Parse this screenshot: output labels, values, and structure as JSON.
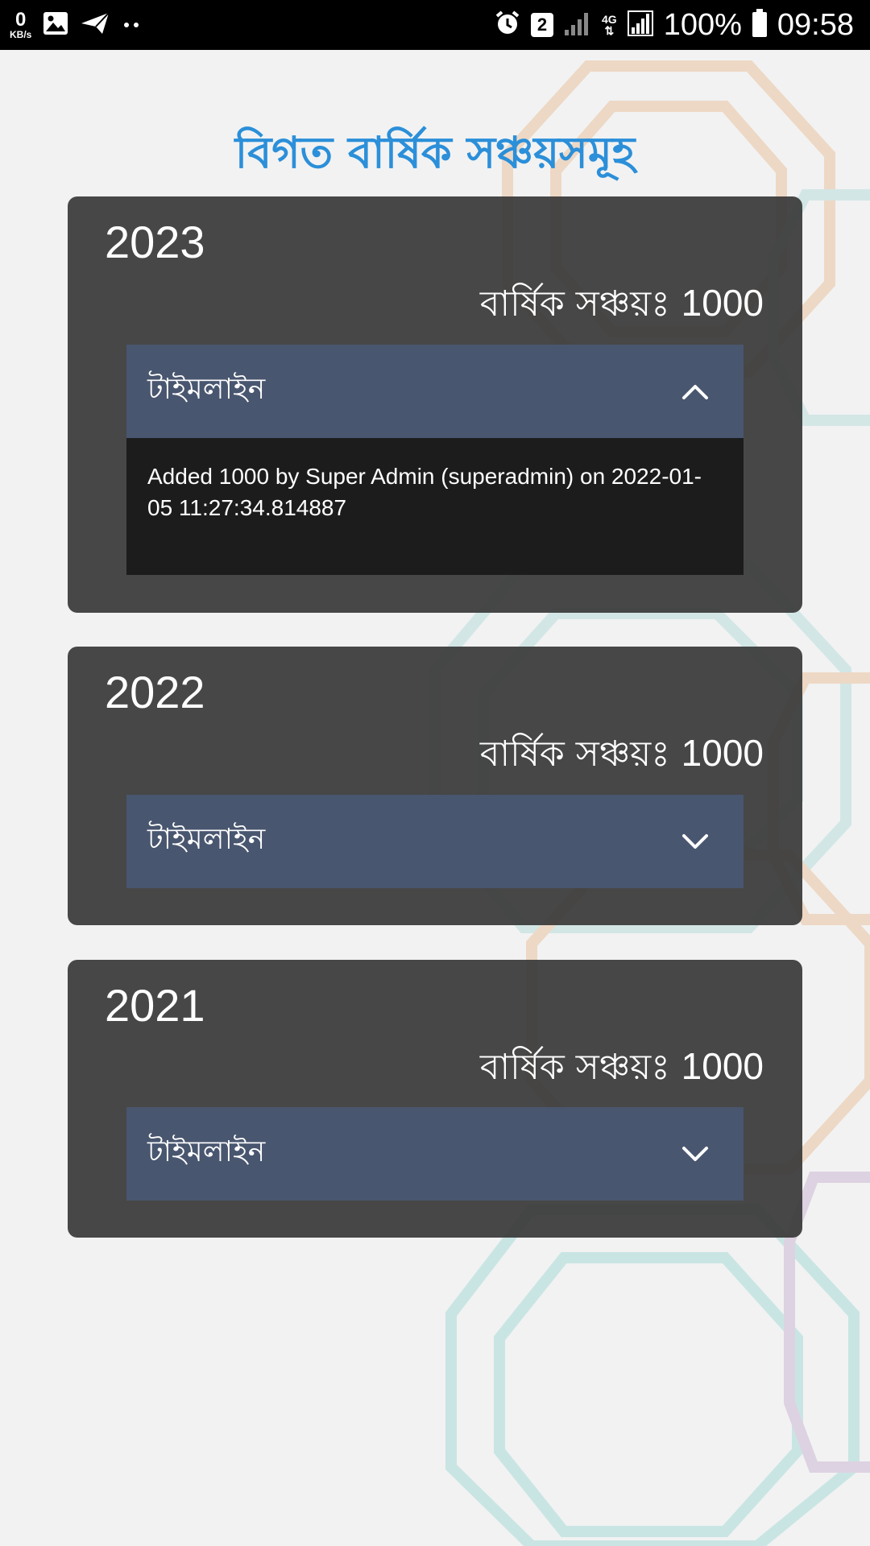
{
  "status_bar": {
    "speed_value": "0",
    "speed_unit": "KB/s",
    "sim_slot": "2",
    "network_type": "4G",
    "battery": "100%",
    "time": "09:58",
    "icons": [
      "image-icon",
      "send-icon",
      "more-dots-icon",
      "alarm-icon",
      "signal-icon",
      "battery-icon"
    ]
  },
  "page": {
    "title": "বিগত বার্ষিক সঞ্চয়সমূহ"
  },
  "cards": [
    {
      "year": "2023",
      "savings_label": "বার্ষিক সঞ্চয়ঃ",
      "savings_amount": "1000",
      "timeline_label": "টাইমলাইন",
      "expanded": true,
      "entries": [
        "Added 1000 by Super Admin (superadmin) on 2022-01-05 11:27:34.814887"
      ]
    },
    {
      "year": "2022",
      "savings_label": "বার্ষিক সঞ্চয়ঃ",
      "savings_amount": "1000",
      "timeline_label": "টাইমলাইন",
      "expanded": false
    },
    {
      "year": "2021",
      "savings_label": "বার্ষিক সঞ্চয়ঃ",
      "savings_amount": "1000",
      "timeline_label": "টাইমলাইন",
      "expanded": false
    }
  ],
  "colors": {
    "title": "#2b8fd9",
    "card_bg": "#383838",
    "timeline_header_bg": "#4a5772",
    "timeline_body_bg": "#1c1c1c"
  }
}
